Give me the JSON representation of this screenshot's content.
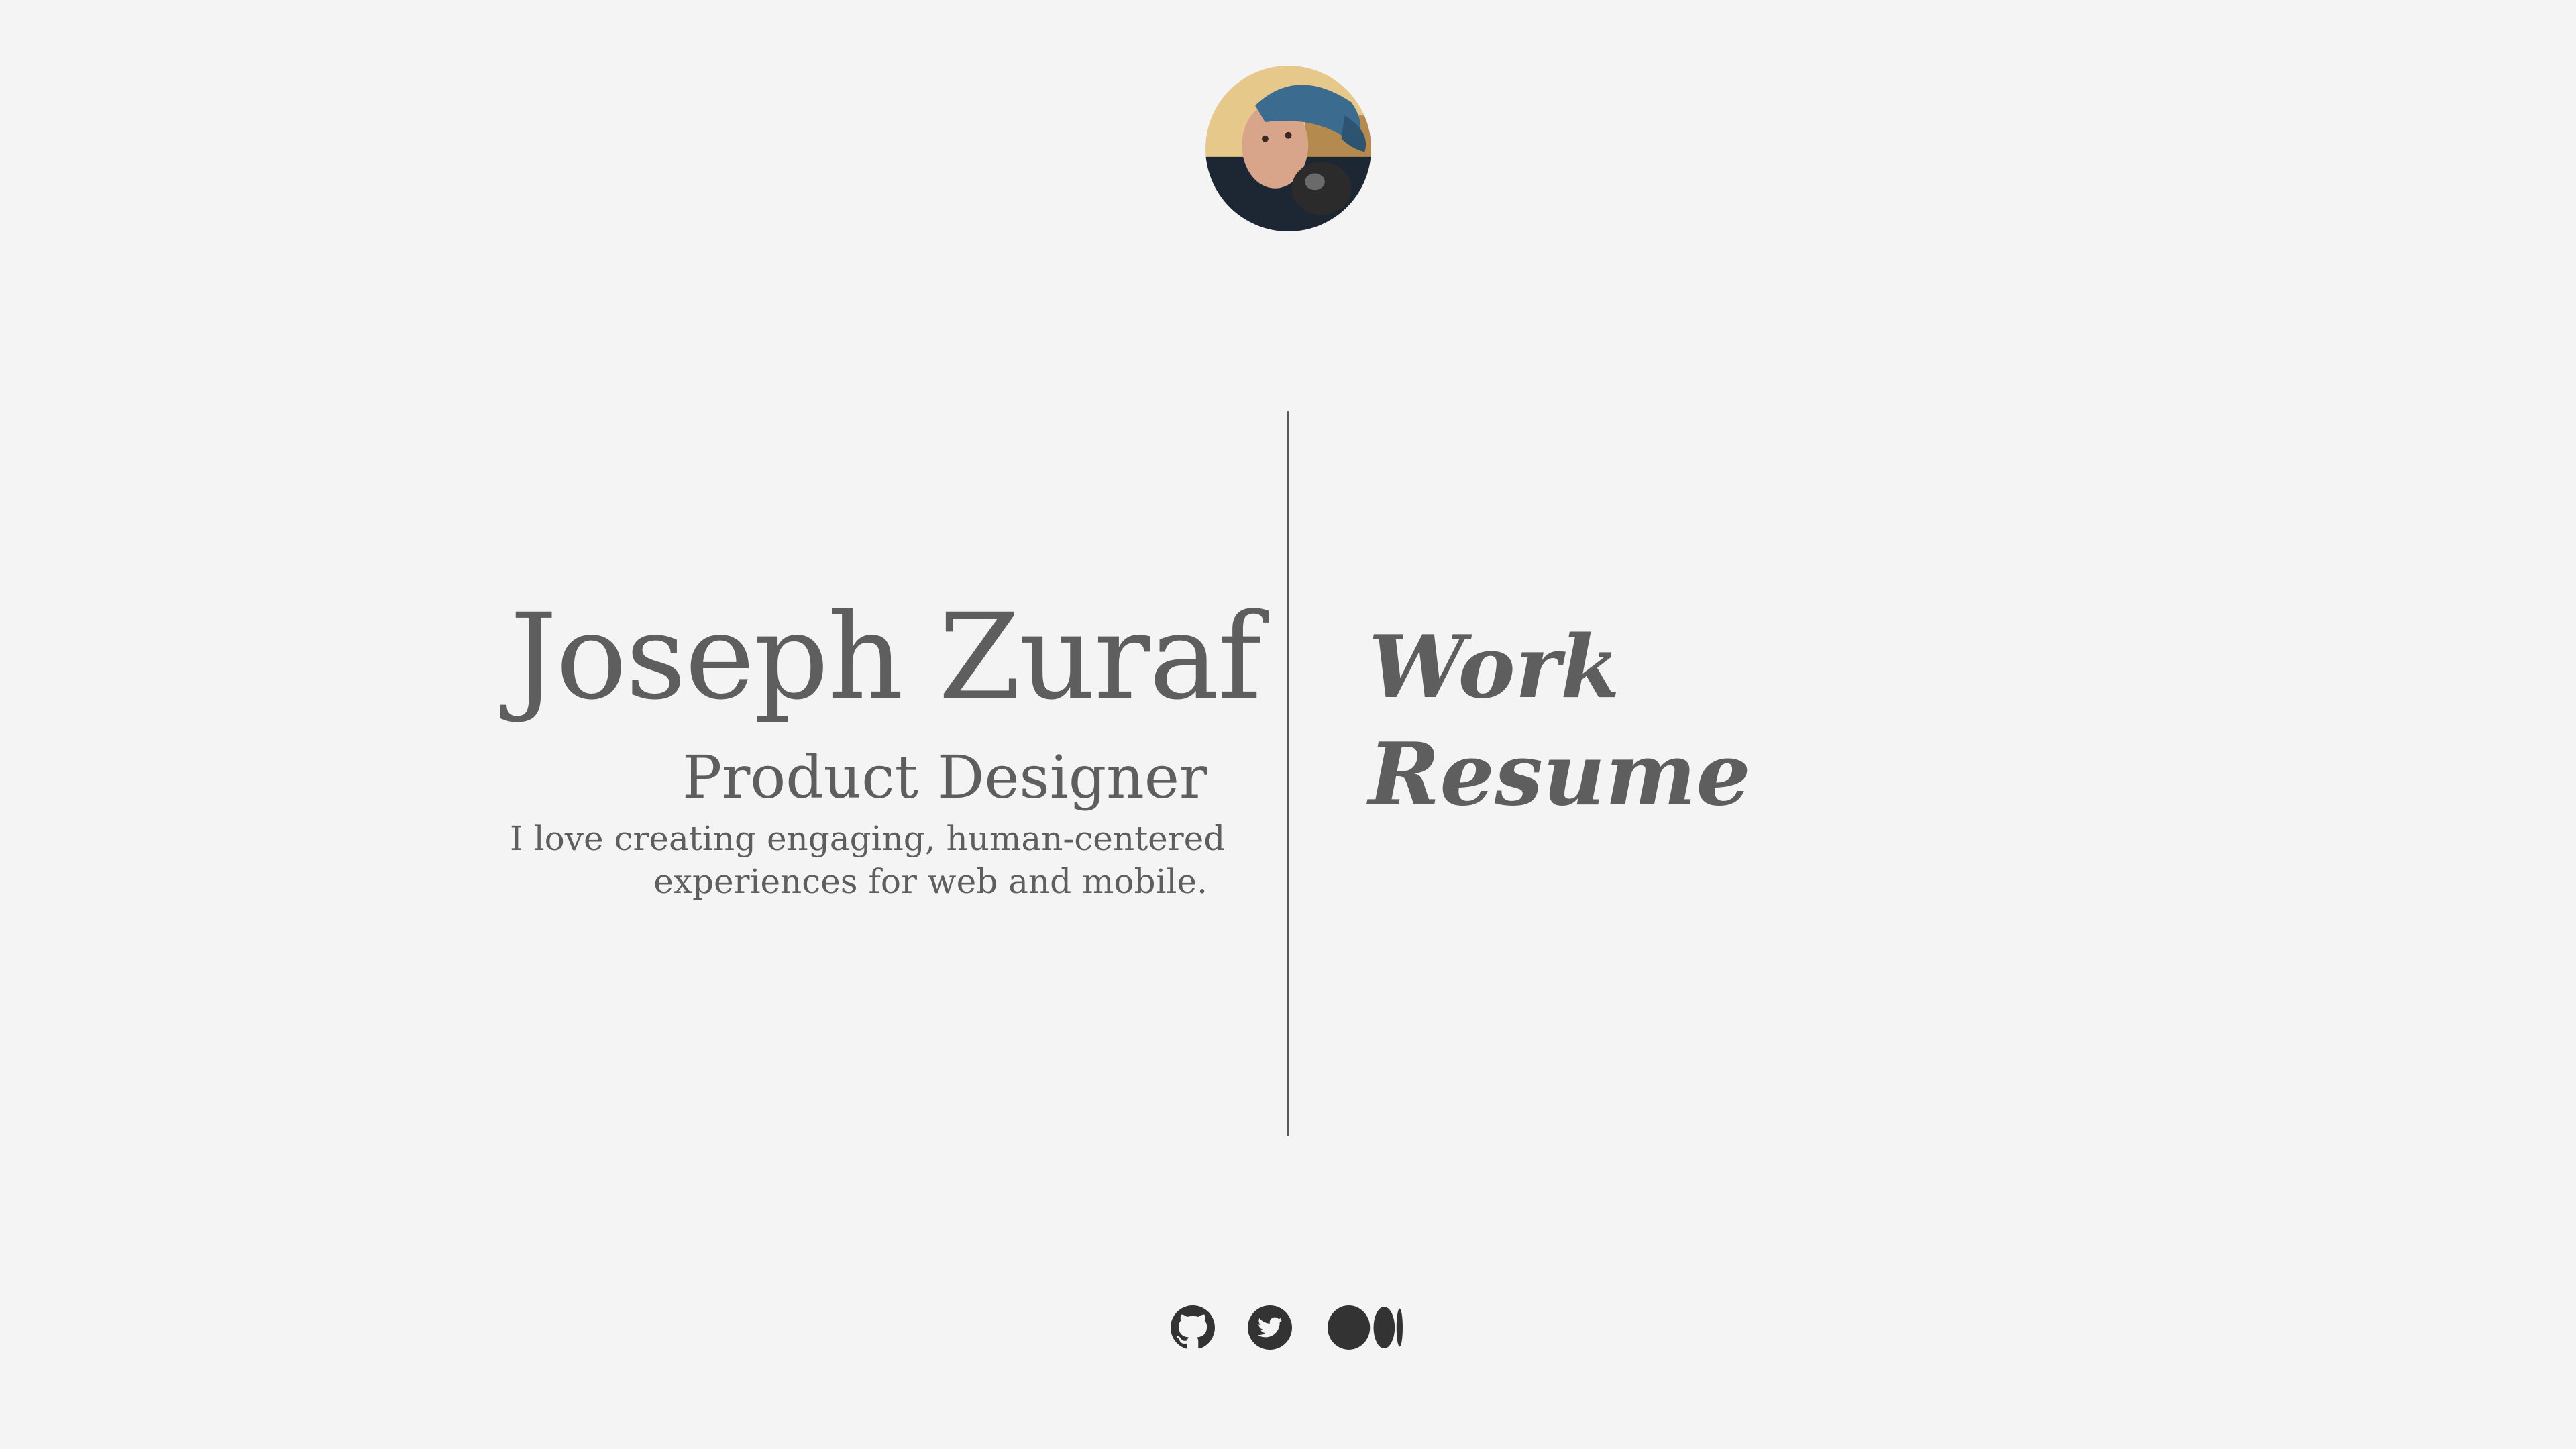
{
  "profile": {
    "name": "Joseph Zuraf",
    "role": "Product Designer",
    "bio_line1": "I love creating engaging, human-centered",
    "bio_line2": "experiences for web and mobile."
  },
  "nav": {
    "work_label": "Work",
    "resume_label": "Resume"
  },
  "social": {
    "icons": [
      "github-icon",
      "twitter-icon",
      "medium-icon"
    ]
  },
  "colors": {
    "background": "#f4f4f4",
    "text": "#5e5e5e",
    "icon": "#333333",
    "divider": "#5a5a5a"
  }
}
